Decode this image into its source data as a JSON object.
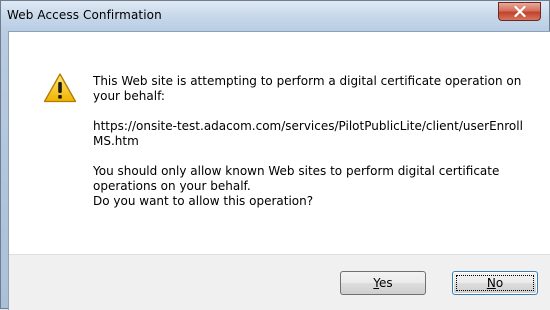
{
  "window": {
    "title": "Web Access Confirmation"
  },
  "icons": {
    "warning": "warning-icon",
    "close": "close-icon"
  },
  "message": {
    "line1": "This Web site is attempting to perform a digital certificate operation on your behalf:",
    "url": "https://onsite-test.adacom.com/services/PilotPublicLite/client/userEnrollMS.htm",
    "line3": "You should only allow known Web sites to perform digital certificate operations on your behalf.",
    "line4": "Do you want to allow this operation?"
  },
  "buttons": {
    "yes": {
      "mnemonic": "Y",
      "rest": "es"
    },
    "no": {
      "mnemonic": "N",
      "rest": "o"
    }
  },
  "colors": {
    "close_button": "#c0432d",
    "warning_fill": "#f3c40a",
    "focus_border": "#3c7fb1"
  }
}
